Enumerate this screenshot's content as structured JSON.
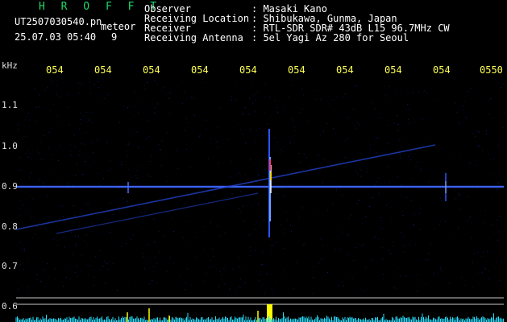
{
  "header": {
    "app_title": "H R O F F T",
    "filename": "UT2507030540.pn",
    "meteor_label": "meteor",
    "timestamp": "25.07.03 05:40",
    "count": "9",
    "info_labels": [
      "Observer",
      "Receiving Location",
      "Receiver",
      "Receiving Antenna"
    ],
    "info_values": [
      ": Masaki Kano",
      ": Shibukawa, Gunma, Japan",
      ": RTL-SDR SDR# 43dB L15 96.7MHz CW",
      ": 5el Yagi Az 280 for Seoul"
    ]
  },
  "axes": {
    "y_unit": "kHz",
    "y_ticks": [
      "1.1",
      "1.0",
      "0.9",
      "0.8",
      "0.7",
      "0.6"
    ],
    "x_ticks": [
      "054",
      "054",
      "054",
      "054",
      "054",
      "054",
      "054",
      "054",
      "054",
      "0550"
    ]
  },
  "colors": {
    "title": "#1fd96a",
    "header_text": "#ffffff",
    "tick_text": "#ffff55",
    "axis_text": "#e0e0e0",
    "carrier": "#2a55ff",
    "spectrum": "#29e0ff",
    "meteor_peak": "#ffff00"
  }
}
